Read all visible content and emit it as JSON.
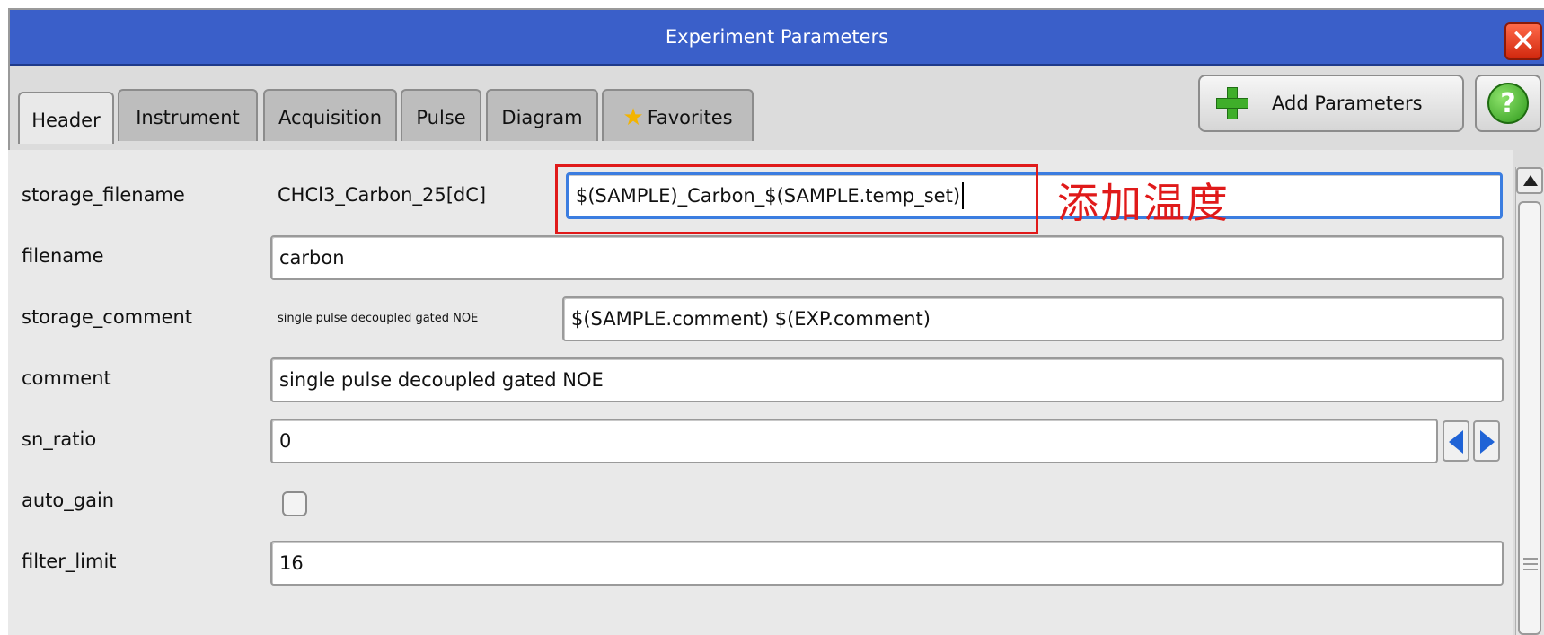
{
  "window": {
    "title": "Experiment Parameters",
    "close_glyph": "✕"
  },
  "tabs": [
    {
      "label": "Header",
      "active": true
    },
    {
      "label": "Instrument"
    },
    {
      "label": "Acquisition"
    },
    {
      "label": "Pulse"
    },
    {
      "label": "Diagram"
    },
    {
      "label": "Favorites",
      "icon": "star-icon"
    }
  ],
  "toolbar": {
    "add_parameters_label": "Add Parameters",
    "add_icon": "plus-icon",
    "help_icon": "help-icon",
    "help_glyph": "?"
  },
  "params": {
    "storage_filename": {
      "label": "storage_filename",
      "current": "CHCl3_Carbon_25[dC]",
      "value": "$(SAMPLE)_Carbon_$(SAMPLE.temp_set)"
    },
    "filename": {
      "label": "filename",
      "value": "carbon"
    },
    "storage_comment": {
      "label": "storage_comment",
      "current": "single pulse decoupled gated NOE",
      "value": "$(SAMPLE.comment) $(EXP.comment)"
    },
    "comment": {
      "label": "comment",
      "value": "single pulse decoupled gated NOE"
    },
    "sn_ratio": {
      "label": "sn_ratio",
      "value": "0"
    },
    "auto_gain": {
      "label": "auto_gain",
      "checked": false
    },
    "filter_limit": {
      "label": "filter_limit",
      "value": "16"
    }
  },
  "annotation": {
    "text": "添加温度",
    "color": "#e01a1a"
  },
  "colors": {
    "titlebar": "#3a5fc9",
    "focus_border": "#3b7de0",
    "stepper_arrow": "#1f63d6"
  }
}
